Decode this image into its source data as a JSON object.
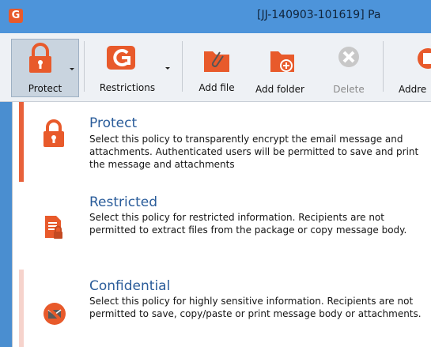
{
  "window": {
    "title": "[JJ-140903-101619] Pa",
    "app_icon": "app-logo-icon"
  },
  "ribbon": {
    "buttons": [
      {
        "label": "Protect",
        "icon": "lock-icon",
        "has_dropdown": true,
        "selected": true
      },
      {
        "label": "Restrictions",
        "icon": "restrictions-icon",
        "has_dropdown": true
      },
      {
        "label": "Add file",
        "icon": "folder-paperclip-icon"
      },
      {
        "label": "Add folder",
        "icon": "folder-add-icon"
      },
      {
        "label": "Delete",
        "icon": "delete-icon",
        "disabled": true
      },
      {
        "label": "Addre",
        "icon": "address-book-icon"
      }
    ]
  },
  "policy_menu": {
    "items": [
      {
        "name": "Protect",
        "description": "Select this policy to transparently encrypt the email message and attachments.  Authenticated users will be permitted to save and print the message and attachments",
        "icon": "lock-icon",
        "highlight_color": "#e8613a"
      },
      {
        "name": "Restricted",
        "description": "Select this policy for restricted information. Recipients are not permitted to extract files from the package or copy message body.",
        "icon": "restricted-document-icon"
      },
      {
        "name": "Confidential",
        "description": "Select this policy for highly sensitive information. Recipients are not permitted to save, copy/paste or print message body or attachments.",
        "icon": "no-envelope-icon",
        "highlight_color": "#f6d3cc"
      }
    ]
  },
  "colors": {
    "accent": "#e85a2b",
    "title_bar": "#4d94da",
    "link_text": "#2a5c9a"
  }
}
